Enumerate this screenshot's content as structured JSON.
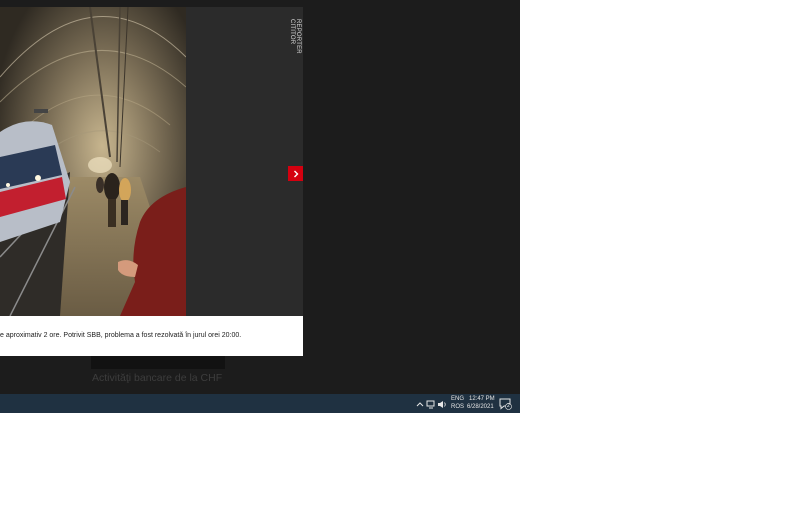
{
  "photo_viewer": {
    "side_label": "REPORTER CITITOR",
    "caption": "e aproximativ 2 ore. Potrivit SBB, problema a fost rezolvată în jurul orei 20:00.",
    "next_icon": "chevron-right-icon"
  },
  "background_article": {
    "headline": "Activităţi bancare de la CHF"
  },
  "taskbar": {
    "language_top": "ENG",
    "language_bottom": "ROS",
    "time": "12:47 PM",
    "date": "6/28/2021",
    "notification_count": "2",
    "icons": [
      "chevron-up-icon",
      "network-icon",
      "volume-icon",
      "notification-icon"
    ]
  }
}
